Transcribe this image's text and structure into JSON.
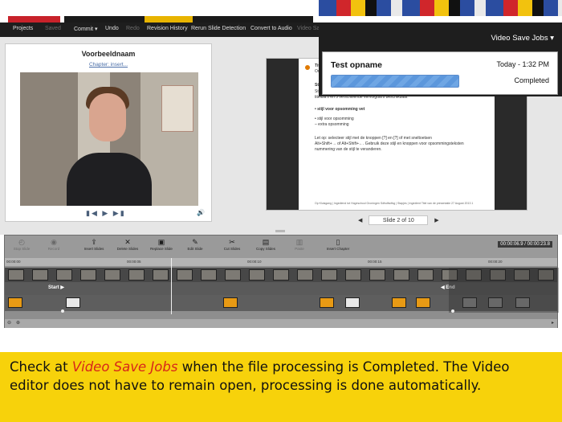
{
  "menubar": {
    "items": [
      {
        "label": "Projects",
        "enabled": true
      },
      {
        "label": "Saved",
        "enabled": false
      },
      {
        "label": "Commit ▾",
        "enabled": true
      },
      {
        "label": "Undo",
        "enabled": true
      },
      {
        "label": "Redo",
        "enabled": false
      },
      {
        "label": "Revision History",
        "enabled": true
      },
      {
        "label": "Rerun Slide Detection",
        "enabled": true
      },
      {
        "label": "Convert to Audio",
        "enabled": true
      },
      {
        "label": "Video Sa",
        "enabled": false
      }
    ]
  },
  "video_panel": {
    "title": "Voorbeeldnaam",
    "chapter_link": "Chapter: insert...",
    "controls": "▮◀ ▶ ▶▮",
    "volume_icon": "speaker-icon"
  },
  "slide": {
    "lines": [
      {
        "text": "Titel en Subject",
        "bold": true
      },
      {
        "text": "Ondertitel",
        "bold": false
      },
      {
        "text": "Stijl voor kopje",
        "bold": true
      },
      {
        "text": "Stijl voor basistekst. Onder de knop 'nieuwe dia' zijn 3 verschillende",
        "bold": false
      },
      {
        "text": "titeldia's en 5 verschillende vervolgdia's beschikbaar.",
        "bold": false
      },
      {
        "text": "•  stijl voor opsomming vet",
        "bold": true
      },
      {
        "text": "•  stijl voor opsomming",
        "bold": false
      },
      {
        "text": "      –  extra opsomming",
        "bold": false
      },
      {
        "text": "Let op: selecteer stijl met de knoppen [?] en [?] of met sneltoetsen",
        "bold": false
      },
      {
        "text": "Alt+Shift+→ of Alt+Shift+←. Gebruik deze stijl en knoppen voor opsommingsteksten",
        "bold": false
      },
      {
        "text": "nummering van de stijl te veranderen.",
        "bold": false
      }
    ],
    "footer": "Op Kluisgang | Ingediend tot Hogeschool Groningen   Sdfsdfsdfsg | Stapjes | Ingedient Titel van de presentatie          27 August 2013          1"
  },
  "slide_nav": {
    "prev": "◀",
    "label": "Slide 2 of 10",
    "next": "▶"
  },
  "jobs": {
    "header": "Video Save Jobs ▾",
    "job": {
      "name": "Test opname",
      "time": "Today - 1:32 PM",
      "status": "Completed",
      "progress": 1.0
    }
  },
  "timeline": {
    "tools": [
      {
        "label": "Stop Slide",
        "icon": "stop-icon",
        "enabled": false
      },
      {
        "label": "Record",
        "icon": "record-icon",
        "enabled": false
      },
      {
        "label": "Insert Slides",
        "icon": "insert-icon",
        "enabled": true
      },
      {
        "label": "Delete Slides",
        "icon": "delete-icon",
        "enabled": true
      },
      {
        "label": "Replace Slide",
        "icon": "replace-icon",
        "enabled": true
      },
      {
        "label": "Edit Slide",
        "icon": "edit-icon",
        "enabled": true
      },
      {
        "label": "Cut Slides",
        "icon": "cut-icon",
        "enabled": true
      },
      {
        "label": "Copy Slides",
        "icon": "copy-icon",
        "enabled": true
      },
      {
        "label": "Paste",
        "icon": "paste-icon",
        "enabled": false
      },
      {
        "label": "Insert Chapter",
        "icon": "chapter-icon",
        "enabled": true
      }
    ],
    "timecode": "00:00:06.9 / 00:00:23.8",
    "ruler": [
      "00:00:00",
      "00:00:05",
      "00:00:10",
      "00:00:15",
      "00:00:20"
    ],
    "start_label": "Start",
    "end_label": "End"
  },
  "caption": {
    "before": "Check at ",
    "highlight": "Video Save Jobs",
    "after": " when the file processing is Completed. The Video editor does not have to remain open, processing is done automatically."
  },
  "colors": {
    "caption_bg": "#f7d20b",
    "highlight": "#d8251a",
    "progress": "#5c97dc"
  }
}
